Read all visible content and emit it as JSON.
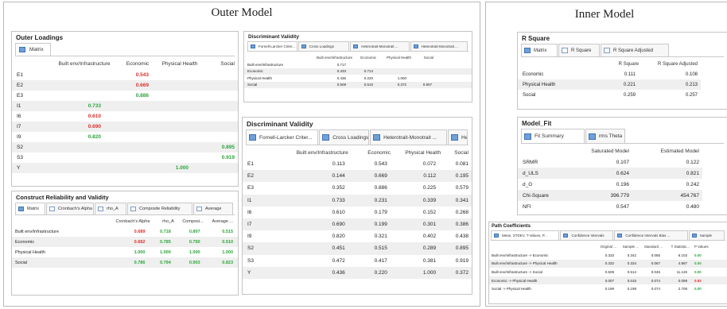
{
  "left": {
    "title": "Outer Model",
    "outer_loadings": {
      "title": "Outer Loadings",
      "tab": "Matrix",
      "columns": [
        "Built env/Infrastructure",
        "Economic",
        "Physical Health",
        "Social"
      ],
      "rows": [
        {
          "label": "E1",
          "cells": [
            "",
            "0.543",
            "",
            ""
          ],
          "cls": [
            "",
            "red",
            "",
            ""
          ]
        },
        {
          "label": "E2",
          "cells": [
            "",
            "0.669",
            "",
            ""
          ],
          "cls": [
            "",
            "red",
            "",
            ""
          ]
        },
        {
          "label": "E3",
          "cells": [
            "",
            "0.886",
            "",
            ""
          ],
          "cls": [
            "",
            "grn",
            "",
            ""
          ]
        },
        {
          "label": "I1",
          "cells": [
            "0.733",
            "",
            "",
            ""
          ],
          "cls": [
            "grn",
            "",
            "",
            ""
          ]
        },
        {
          "label": "I6",
          "cells": [
            "0.610",
            "",
            "",
            ""
          ],
          "cls": [
            "red",
            "",
            "",
            ""
          ]
        },
        {
          "label": "I7",
          "cells": [
            "0.690",
            "",
            "",
            ""
          ],
          "cls": [
            "red",
            "",
            "",
            ""
          ]
        },
        {
          "label": "I9",
          "cells": [
            "0.820",
            "",
            "",
            ""
          ],
          "cls": [
            "grn",
            "",
            "",
            ""
          ]
        },
        {
          "label": "S2",
          "cells": [
            "",
            "",
            "",
            "0.895"
          ],
          "cls": [
            "",
            "",
            "",
            "grn"
          ]
        },
        {
          "label": "S3",
          "cells": [
            "",
            "",
            "",
            "0.919"
          ],
          "cls": [
            "",
            "",
            "",
            "grn"
          ]
        },
        {
          "label": "Y",
          "cells": [
            "",
            "",
            "1.000",
            ""
          ],
          "cls": [
            "",
            "",
            "grn",
            ""
          ]
        }
      ]
    },
    "reliability": {
      "title": "Construct Reliability and Validity",
      "tabs": [
        "Matrix",
        "Cronbach's Alpha",
        "rho_A",
        "Composite Reliability",
        "Average"
      ],
      "columns": [
        "Cronbach's Alpha",
        "rho_A",
        "Composi...",
        "Average ..."
      ],
      "rows": [
        {
          "label": "Built env/Infrastructure",
          "cells": [
            "0.689",
            "0.718",
            "0.807",
            "0.515"
          ],
          "cls": [
            "red",
            "grn",
            "grn",
            "grn"
          ]
        },
        {
          "label": "Economic",
          "cells": [
            "0.682",
            "0.785",
            "0.750",
            "0.510"
          ],
          "cls": [
            "red",
            "grn",
            "grn",
            "grn"
          ]
        },
        {
          "label": "Physical Health",
          "cells": [
            "1.000",
            "1.000",
            "1.000",
            "1.000"
          ],
          "cls": [
            "grn",
            "grn",
            "grn",
            "grn"
          ]
        },
        {
          "label": "Social",
          "cells": [
            "0.786",
            "0.794",
            "0.903",
            "0.823"
          ],
          "cls": [
            "grn",
            "grn",
            "grn",
            "grn"
          ]
        }
      ]
    },
    "disc_small": {
      "title": "Discriminant Validity",
      "tabs": [
        "Fornell-Larcker Criter...",
        "Cross Loadings",
        "Heterotrait-Monotrait ...",
        "Heterotrait-Monotrait ..."
      ],
      "columns": [
        "Built env/Infrastructure",
        "Economic",
        "Physical Health",
        "Social"
      ],
      "rows": [
        {
          "label": "Built env/Infrastructure",
          "cells": [
            "0.717",
            "",
            "",
            ""
          ]
        },
        {
          "label": "Economic",
          "cells": [
            "0.333",
            "0.714",
            "",
            ""
          ]
        },
        {
          "label": "Physical Health",
          "cells": [
            "0.436",
            "0.220",
            "1.000",
            ""
          ]
        },
        {
          "label": "Social",
          "cells": [
            "0.509",
            "0.510",
            "0.372",
            "0.907"
          ]
        }
      ]
    },
    "disc_large": {
      "title": "Discriminant Validity",
      "tabs": [
        "Fornell-Larcker Criter...",
        "Cross Loadings",
        "Heterotrait-Monotrait ...",
        "He"
      ],
      "columns": [
        "Built env/Infrastructure",
        "Economic",
        "Physical Health",
        "Social"
      ],
      "rows": [
        {
          "label": "E1",
          "cells": [
            "0.113",
            "0.543",
            "0.072",
            "0.081"
          ]
        },
        {
          "label": "E2",
          "cells": [
            "0.144",
            "0.669",
            "0.112",
            "0.195"
          ]
        },
        {
          "label": "E3",
          "cells": [
            "0.352",
            "0.886",
            "0.225",
            "0.579"
          ]
        },
        {
          "label": "I1",
          "cells": [
            "0.733",
            "0.231",
            "0.339",
            "0.341"
          ]
        },
        {
          "label": "I6",
          "cells": [
            "0.610",
            "0.179",
            "0.152",
            "0.268"
          ]
        },
        {
          "label": "I7",
          "cells": [
            "0.690",
            "0.199",
            "0.301",
            "0.386"
          ]
        },
        {
          "label": "I9",
          "cells": [
            "0.820",
            "0.321",
            "0.402",
            "0.438"
          ]
        },
        {
          "label": "S2",
          "cells": [
            "0.451",
            "0.515",
            "0.289",
            "0.895"
          ]
        },
        {
          "label": "S3",
          "cells": [
            "0.472",
            "0.417",
            "0.381",
            "0.919"
          ]
        },
        {
          "label": "Y",
          "cells": [
            "0.436",
            "0.220",
            "1.000",
            "0.372"
          ]
        }
      ]
    }
  },
  "right": {
    "title": "Inner Model",
    "r_square": {
      "title": "R Square",
      "tabs": [
        "Matrix",
        "R Square",
        "R Square Adjusted"
      ],
      "columns": [
        "R Square",
        "R Square Adjusted"
      ],
      "rows": [
        {
          "label": "Economic",
          "cells": [
            "0.111",
            "0.108"
          ]
        },
        {
          "label": "Physical Health",
          "cells": [
            "0.221",
            "0.213"
          ]
        },
        {
          "label": "Social",
          "cells": [
            "0.259",
            "0.257"
          ]
        }
      ]
    },
    "model_fit": {
      "title": "Model_Fit",
      "tabs": [
        "Fit Summary",
        "rms Theta"
      ],
      "columns": [
        "Saturated Model",
        "Estimated Model"
      ],
      "rows": [
        {
          "label": "SRMR",
          "cells": [
            "0.107",
            "0.122"
          ]
        },
        {
          "label": "d_ULS",
          "cells": [
            "0.624",
            "0.821"
          ]
        },
        {
          "label": "d_G",
          "cells": [
            "0.196",
            "0.242"
          ]
        },
        {
          "label": "Chi-Square",
          "cells": [
            "396.779",
            "454.767"
          ]
        },
        {
          "label": "NFI",
          "cells": [
            "0.547",
            "0.480"
          ]
        }
      ]
    },
    "path_coeff": {
      "title": "Path Coefficients",
      "tabs": [
        "Mean, STDEV, T-Values, P...",
        "Confidence Intervals",
        "Confidence Intervals Bias ...",
        "Sample"
      ],
      "columns": [
        "Original ...",
        "Sample ...",
        "Standard ...",
        "T Statistic...",
        "P Values"
      ],
      "rows": [
        {
          "label": "Built env/Infrastructure -> Economic",
          "cells": [
            "0.333",
            "0.342",
            "0.055",
            "6.103",
            "0.00"
          ],
          "cls": [
            "",
            "",
            "",
            "",
            "grn"
          ]
        },
        {
          "label": "Built env/Infrastructure -> Physical Health",
          "cells": [
            "0.332",
            "0.334",
            "0.067",
            "4.987",
            "0.00"
          ],
          "cls": [
            "",
            "",
            "",
            "",
            "grn"
          ]
        },
        {
          "label": "Built env/Infrastructure -> Social",
          "cells": [
            "0.509",
            "0.514",
            "0.046",
            "11.126",
            "0.00"
          ],
          "cls": [
            "",
            "",
            "",
            "",
            "grn"
          ]
        },
        {
          "label": "Economic -> Physical Health",
          "cells": [
            "0.007",
            "0.015",
            "0.074",
            "0.099",
            "0.92"
          ],
          "cls": [
            "",
            "",
            "",
            "",
            "red"
          ]
        },
        {
          "label": "Social -> Physical Health",
          "cells": [
            "0.199",
            "0.198",
            "0.074",
            "2.708",
            "0.00"
          ],
          "cls": [
            "",
            "",
            "",
            "",
            "grn"
          ]
        }
      ]
    }
  }
}
